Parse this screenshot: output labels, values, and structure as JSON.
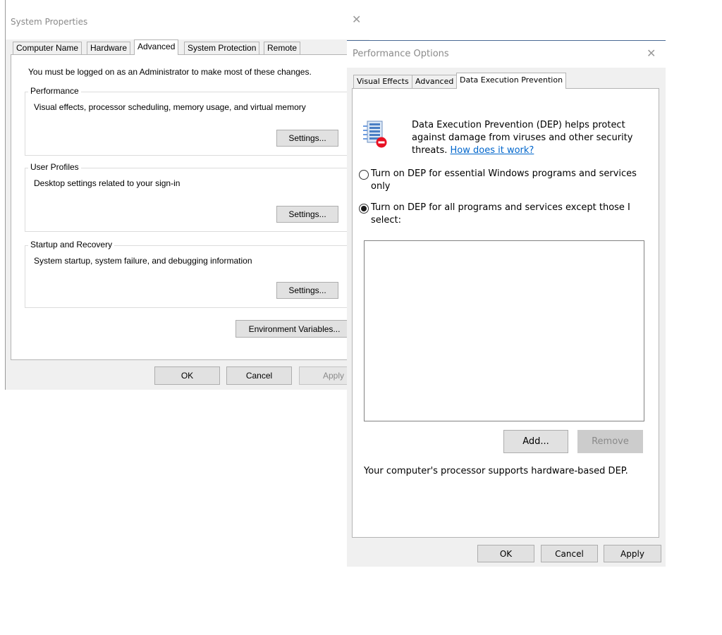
{
  "system_properties": {
    "title": "System Properties",
    "tabs": [
      {
        "label": "Computer Name"
      },
      {
        "label": "Hardware"
      },
      {
        "label": "Advanced"
      },
      {
        "label": "System Protection"
      },
      {
        "label": "Remote"
      }
    ],
    "active_tab": "Advanced",
    "admin_note": "You must be logged on as an Administrator to make most of these changes.",
    "groups": {
      "performance": {
        "title": "Performance",
        "description": "Visual effects, processor scheduling, memory usage, and virtual memory",
        "button": "Settings..."
      },
      "user_profiles": {
        "title": "User Profiles",
        "description": "Desktop settings related to your sign-in",
        "button": "Settings..."
      },
      "startup_recovery": {
        "title": "Startup and Recovery",
        "description": "System startup, system failure, and debugging information",
        "button": "Settings..."
      }
    },
    "environment_variables_button": "Environment Variables...",
    "buttons": {
      "ok": "OK",
      "cancel": "Cancel",
      "apply": "Apply"
    }
  },
  "performance_options": {
    "title": "Performance Options",
    "tabs": [
      {
        "label": "Visual Effects"
      },
      {
        "label": "Advanced"
      },
      {
        "label": "Data Execution Prevention"
      }
    ],
    "active_tab": "Data Execution Prevention",
    "dep_description": "Data Execution Prevention (DEP) helps protect against damage from viruses and other security threats.",
    "help_link": "How does it work?",
    "radio_options": [
      {
        "label": "Turn on DEP for essential Windows programs and services only",
        "selected": false
      },
      {
        "label": "Turn on DEP for all programs and services except those I select:",
        "selected": true
      }
    ],
    "add_button": "Add...",
    "remove_button": "Remove",
    "hardware_note": "Your computer's processor supports hardware-based DEP.",
    "buttons": {
      "ok": "OK",
      "cancel": "Cancel",
      "apply": "Apply"
    }
  },
  "icons": {
    "dep": "dep-shield-icon",
    "close": "close-icon"
  }
}
